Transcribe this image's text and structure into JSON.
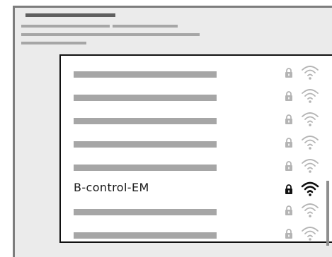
{
  "network_list": {
    "networks": [
      {
        "name": "",
        "secured": true,
        "selected": false,
        "icons": [
          "lock-icon",
          "wifi-icon"
        ]
      },
      {
        "name": "",
        "secured": true,
        "selected": false,
        "icons": [
          "lock-icon",
          "wifi-icon"
        ]
      },
      {
        "name": "",
        "secured": true,
        "selected": false,
        "icons": [
          "lock-icon",
          "wifi-icon"
        ]
      },
      {
        "name": "",
        "secured": true,
        "selected": false,
        "icons": [
          "lock-icon",
          "wifi-icon"
        ]
      },
      {
        "name": "",
        "secured": true,
        "selected": false,
        "icons": [
          "lock-icon",
          "wifi-icon"
        ]
      },
      {
        "name": "B-control-EM",
        "secured": true,
        "selected": true,
        "icons": [
          "lock-icon",
          "wifi-icon"
        ]
      },
      {
        "name": "",
        "secured": true,
        "selected": false,
        "icons": [
          "lock-icon",
          "wifi-icon"
        ]
      },
      {
        "name": "",
        "secured": true,
        "selected": false,
        "icons": [
          "lock-icon",
          "wifi-icon"
        ]
      }
    ]
  },
  "colors": {
    "active_icon": "#111111",
    "inactive_icon": "#b4b4b4",
    "placeholder_bar": "#a6a6a6",
    "window_bg": "#ebebeb",
    "panel_border": "#111111"
  }
}
